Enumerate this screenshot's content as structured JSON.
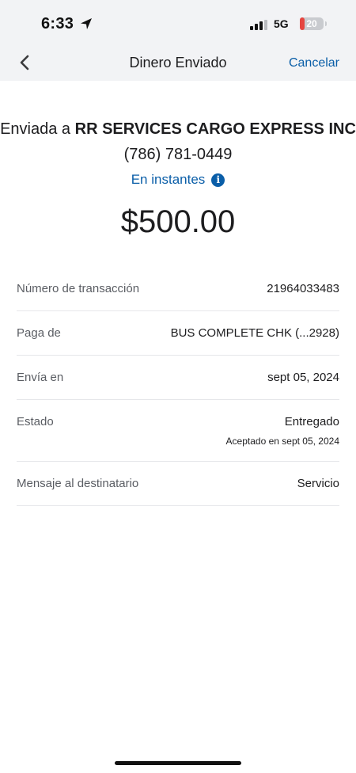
{
  "status_bar": {
    "time": "6:33",
    "network": "5G",
    "battery_level": "20",
    "battery_fraction": 0.2,
    "battery_color": "#e5453f",
    "icons": [
      "location-arrow-icon",
      "cellular-signal-icon",
      "battery-icon"
    ]
  },
  "nav": {
    "title": "Dinero Enviado",
    "cancel_label": "Cancelar",
    "back_icon": "chevron-left-icon"
  },
  "summary": {
    "recipient_prefix": "Enviada a",
    "recipient_name": "RR SERVICES CARGO EXPRESS INC",
    "recipient_phone": "(786) 781-0449",
    "speed_label": "En instantes",
    "info_icon": "info-icon",
    "amount": "$500.00"
  },
  "details": [
    {
      "label": "Número de transacción",
      "value": "21964033483"
    },
    {
      "label": "Paga de",
      "value": "BUS COMPLETE CHK (...2928)"
    },
    {
      "label": "Envía en",
      "value": "sept 05, 2024"
    },
    {
      "label": "Estado",
      "value": "Entregado",
      "sub": "Aceptado en sept 05, 2024"
    },
    {
      "label": "Mensaje al destinatario",
      "value": "Servicio"
    }
  ],
  "colors": {
    "accent": "#0a5ea8",
    "header_bg": "#f2f3f5"
  }
}
